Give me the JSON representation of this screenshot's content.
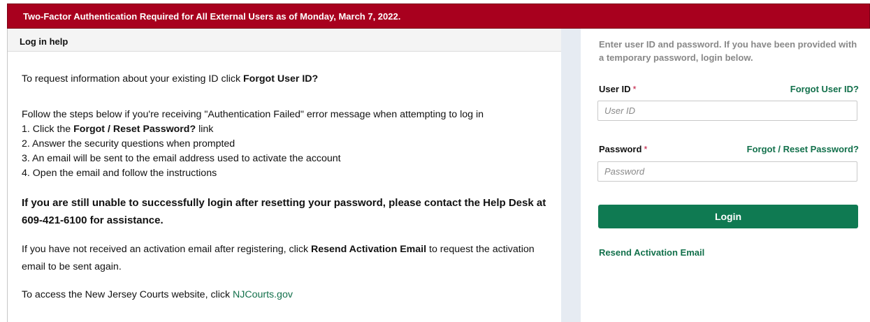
{
  "banner": {
    "text": "Two-Factor Authentication Required for All External Users as of Monday, March 7, 2022."
  },
  "help": {
    "title": "Log in help",
    "line1_prefix": "To request information about your existing ID click ",
    "line1_bold": "Forgot User ID?",
    "line2": "Follow the steps below if you're receiving \"Authentication Failed\" error message when attempting to log in",
    "step1_prefix": "1. Click the ",
    "step1_bold": "Forgot / Reset Password?",
    "step1_suffix": " link",
    "step2": "2. Answer the security questions when prompted",
    "step3": "3. An email will be sent to the email address used to activate the account",
    "step4": "4. Open the email and follow the instructions",
    "contact": "If you are still unable to successfully login after resetting your password, please contact the Help Desk at 609-421-6100 for assistance.",
    "resend_prefix": "If you have not received an activation email after registering, click ",
    "resend_bold": "Resend Activation Email",
    "resend_suffix": " to request the activation email to be sent again.",
    "courts_prefix": "To access the New Jersey Courts website, click ",
    "courts_link": "NJCourts.gov"
  },
  "login": {
    "intro": "Enter user ID and password. If you have been provided with a temporary password, login below.",
    "userid_label": "User ID",
    "required_mark": "*",
    "forgot_userid": "Forgot User ID?",
    "userid_placeholder": "User ID",
    "password_label": "Password",
    "forgot_password": "Forgot / Reset Password?",
    "password_placeholder": "Password",
    "login_button": "Login",
    "resend_link": "Resend Activation Email"
  },
  "colors": {
    "banner": "#a8001e",
    "accent_green": "#0f7a52",
    "required": "#c0143c"
  }
}
